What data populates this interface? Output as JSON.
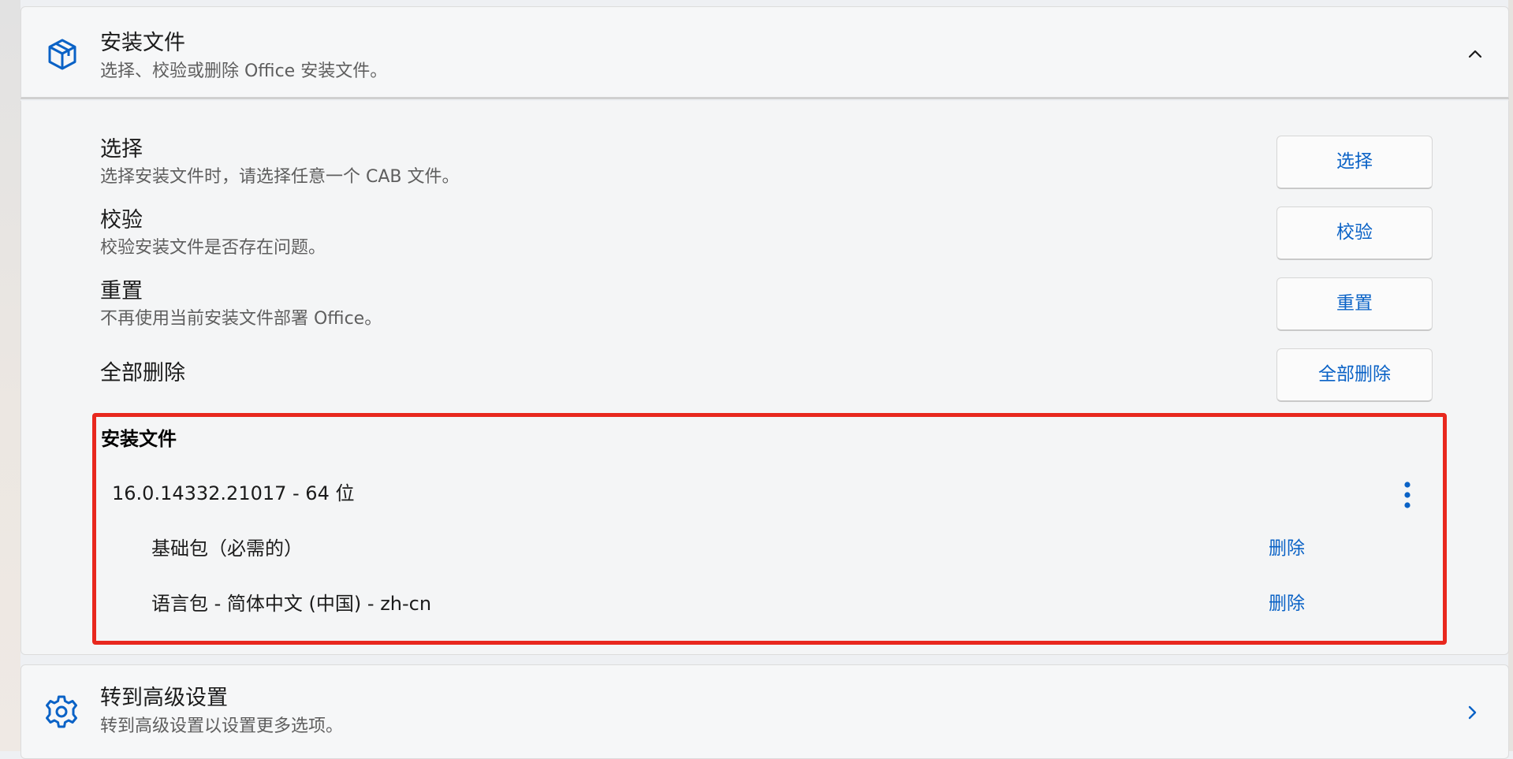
{
  "install_section": {
    "icon": "package-box-icon",
    "title": "安装文件",
    "description": "选择、校验或删除 Office 安装文件。",
    "collapse_icon": "chevron-up-icon"
  },
  "settings": [
    {
      "title": "选择",
      "description": "选择安装文件时，请选择任意一个 CAB 文件。",
      "button": "选择"
    },
    {
      "title": "校验",
      "description": "校验安装文件是否存在问题。",
      "button": "校验"
    },
    {
      "title": "重置",
      "description": "不再使用当前安装文件部署 Office。",
      "button": "重置"
    },
    {
      "title": "全部删除",
      "description": "",
      "button": "全部删除"
    }
  ],
  "install_files": {
    "heading": "安装文件",
    "version": "16.0.14332.21017 - 64 位",
    "more_icon": "more-vertical-icon",
    "packages": [
      {
        "name": "基础包（必需的）",
        "action": "删除"
      },
      {
        "name": "语言包 - 简体中文 (中国) - zh-cn",
        "action": "删除"
      }
    ]
  },
  "advanced": {
    "icon": "gear-icon",
    "title": "转到高级设置",
    "description": "转到高级设置以设置更多选项。",
    "nav_icon": "chevron-right-icon"
  },
  "colors": {
    "accent": "#0a62c6",
    "highlight_border": "#e8281e"
  }
}
